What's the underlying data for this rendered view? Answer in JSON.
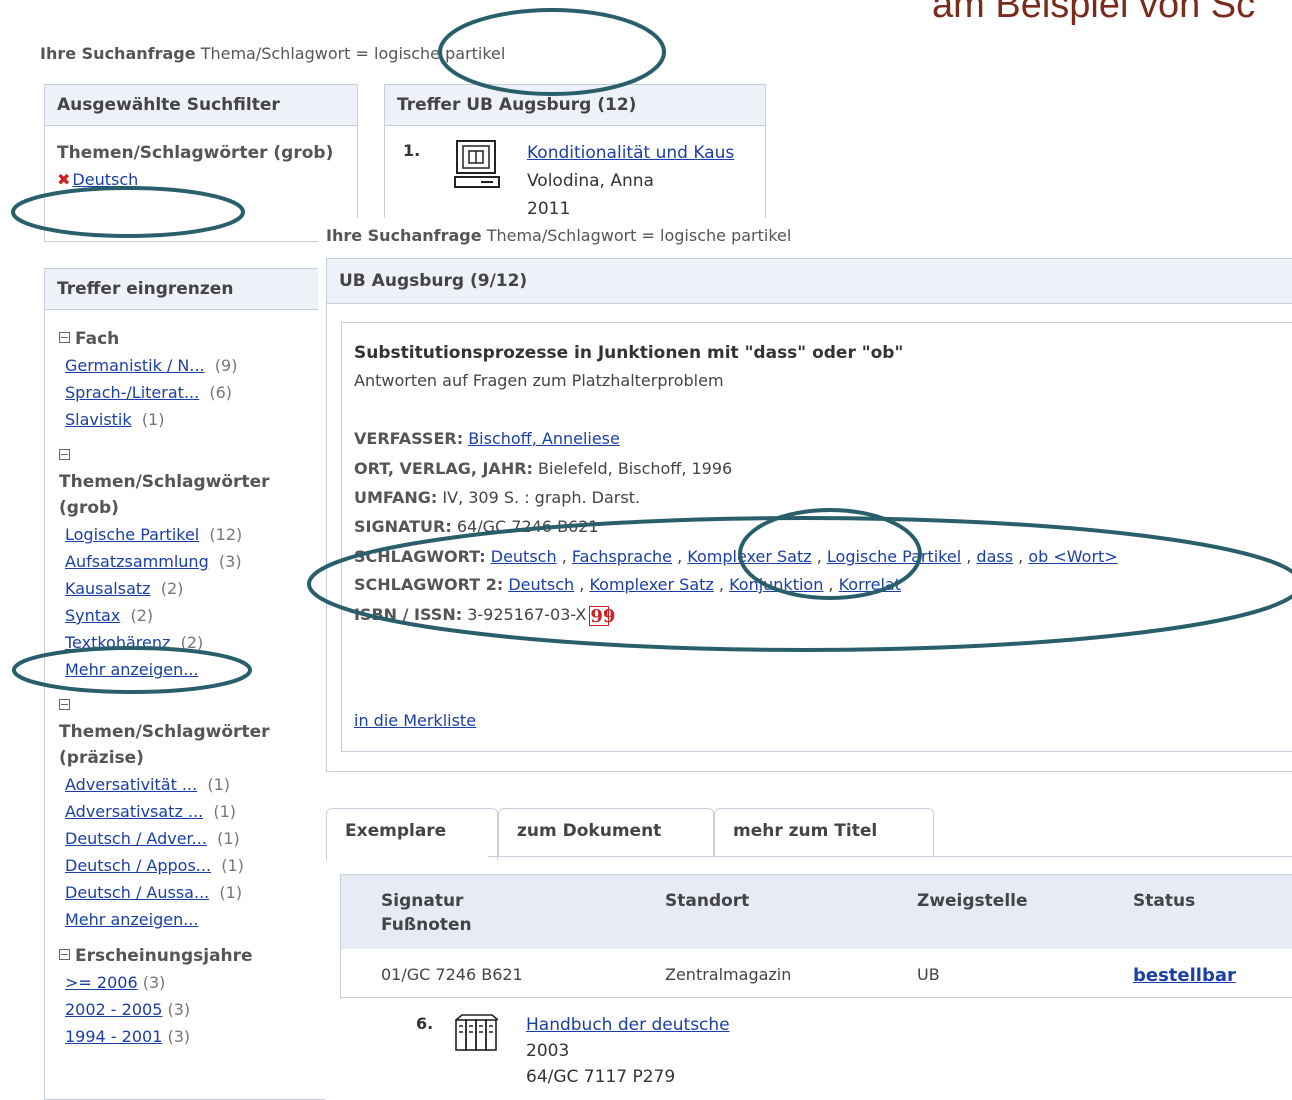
{
  "slide": {
    "title": "am Beispiel von Sc"
  },
  "query_bg": {
    "label": "Ihre Suchanfrage",
    "field": "Thema/Schlagwort",
    "eq": "=",
    "value": "logische partikel"
  },
  "selected_filters": {
    "heading": "Ausgewählte Suchfilter",
    "group": "Themen/Schlagwörter (grob)",
    "remove_icon": "x-remove-icon",
    "active": "Deutsch"
  },
  "hits_bg": {
    "heading": "Treffer UB Augsburg (12)",
    "item1": {
      "number": "1.",
      "icon": "computer-icon",
      "title": "Konditionalität und Kaus",
      "author": "Volodina, Anna",
      "year": "2011"
    },
    "item6": {
      "number": "6.",
      "icon": "books-icon",
      "title": "Handbuch der deutsche",
      "year": "2003",
      "signature": "64/GC 7117 P279"
    }
  },
  "narrow": {
    "heading": "Treffer eingrenzen",
    "facets": [
      {
        "title": "Fach",
        "items": [
          {
            "label": "Germanistik / N...",
            "count": "(9)"
          },
          {
            "label": "Sprach-/Literat...",
            "count": "(6)"
          },
          {
            "label": "Slavistik",
            "count": "(1)"
          }
        ]
      },
      {
        "title": "Themen/Schlagwörter (grob)",
        "items": [
          {
            "label": "Logische Partikel",
            "count": "(12)"
          },
          {
            "label": "Aufsatzsammlung",
            "count": "(3)"
          },
          {
            "label": "Kausalsatz",
            "count": "(2)"
          },
          {
            "label": "Syntax",
            "count": "(2)"
          },
          {
            "label": "Textkohärenz",
            "count": "(2)"
          },
          {
            "label": "Mehr anzeigen...",
            "count": ""
          }
        ]
      },
      {
        "title": "Themen/Schlagwörter (präzise)",
        "items": [
          {
            "label": "Adversativität ...",
            "count": "(1)"
          },
          {
            "label": "Adversativsatz ...",
            "count": "(1)"
          },
          {
            "label": "Deutsch / Adver...",
            "count": "(1)"
          },
          {
            "label": "Deutsch / Appos...",
            "count": "(1)"
          },
          {
            "label": "Deutsch / Aussa...",
            "count": "(1)"
          },
          {
            "label": "Mehr anzeigen...",
            "count": ""
          }
        ]
      },
      {
        "title": "Erscheinungsjahre",
        "items": [
          {
            "label": ">= 2006",
            "count": "(3)"
          },
          {
            "label": "2002 - 2005",
            "count": "(3)"
          },
          {
            "label": "1994 - 2001",
            "count": "(3)"
          }
        ]
      }
    ]
  },
  "query_fg": {
    "label": "Ihre Suchanfrage",
    "text": "Thema/Schlagwort = logische partikel"
  },
  "record": {
    "header": "UB Augsburg (9/12)",
    "title": "Substitutionsprozesse in Junktionen mit \"dass\" oder \"ob\"",
    "subtitle": "Antworten auf Fragen zum Platzhalterproblem",
    "verfasser_label": "VERFASSER:",
    "verfasser": "Bischoff, Anneliese",
    "ort_label": "ORT, VERLAG, JAHR:",
    "ort": "Bielefeld, Bischoff, 1996",
    "umfang_label": "UMFANG:",
    "umfang": "IV, 309 S. : graph. Darst.",
    "signatur_label": "SIGNATUR:",
    "signatur": "64/GC 7246 B621",
    "schlagwort_label": "SCHLAGWORT:",
    "schlagwort": [
      "Deutsch",
      "Fachsprache",
      "Komplexer Satz",
      "Logische Partikel",
      "dass",
      "ob <Wort>"
    ],
    "schlagwort2_label": "SCHLAGWORT 2:",
    "schlagwort2": [
      "Deutsch",
      "Komplexer Satz",
      "Konjunktion",
      "Korrelat"
    ],
    "isbn_label": "ISBN / ISSN:",
    "isbn": "3-925167-03-X",
    "quote_icon": "citation-icon",
    "quote_glyph": "99",
    "merkliste": "in die Merkliste"
  },
  "tabs": [
    "Exemplare",
    "zum Dokument",
    "mehr zum Titel"
  ],
  "copies": {
    "headers": [
      "Signatur",
      "Fußnoten",
      "Standort",
      "Zweigstelle",
      "Status"
    ],
    "row": {
      "signatur": "01/GC 7246 B621",
      "standort": "Zentralmagazin",
      "zweigstelle": "UB",
      "status": "bestellbar"
    }
  },
  "colors": {
    "annotation": "#285f6a",
    "link": "#1a3fa8",
    "title": "#7a2b1d",
    "remove": "#cc2020"
  }
}
